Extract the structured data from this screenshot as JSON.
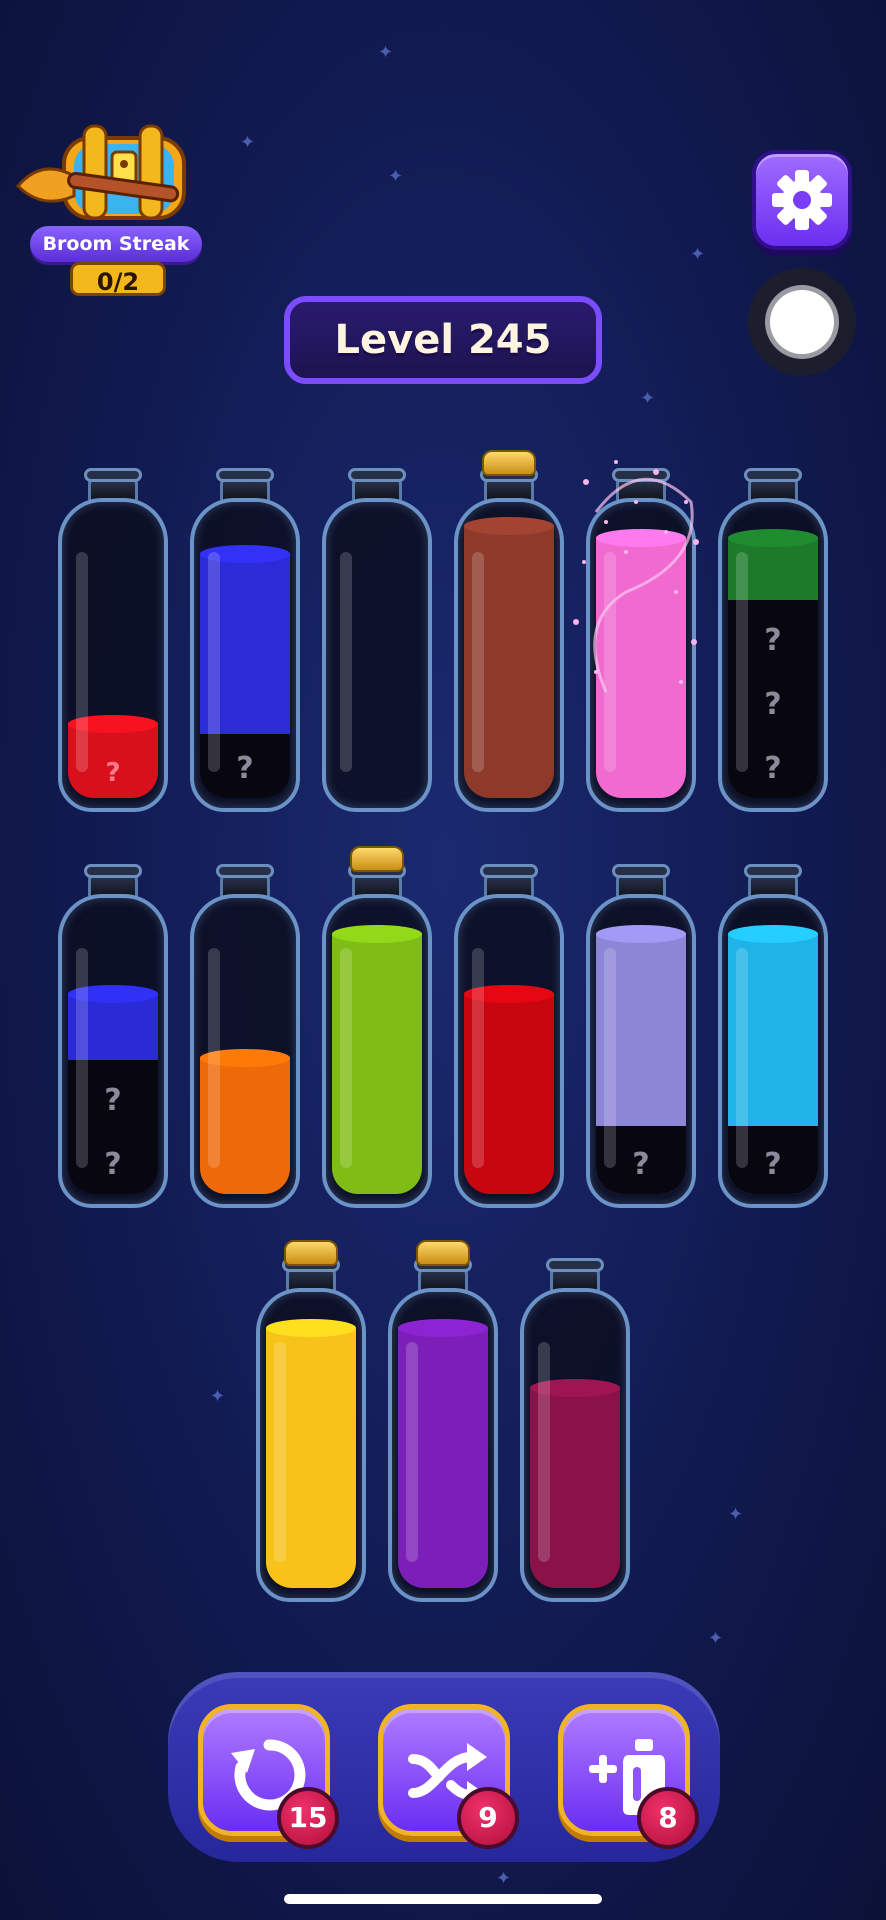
{
  "header": {
    "broom_streak_label": "Broom Streak",
    "broom_streak_count": "0/2",
    "level_label": "Level 245"
  },
  "bottles": [
    {
      "id": 1,
      "row": 1,
      "corked": false,
      "layers": [
        {
          "color": "#d8101c",
          "hidden_marker": "?"
        }
      ],
      "fill_fraction": 0.25
    },
    {
      "id": 2,
      "row": 1,
      "corked": false,
      "hidden_segments": 1,
      "visible_color": "#2c2bd8",
      "fill_fraction": 0.75
    },
    {
      "id": 3,
      "row": 1,
      "corked": false,
      "fill_fraction": 0
    },
    {
      "id": 4,
      "row": 1,
      "corked": true,
      "visible_color": "#8e3a2b",
      "fill_fraction": 1.0
    },
    {
      "id": 5,
      "row": 1,
      "corked": false,
      "visible_color": "#f06ad0",
      "fill_fraction": 1.0,
      "sparkle": true
    },
    {
      "id": 6,
      "row": 1,
      "corked": false,
      "hidden_segments": 3,
      "visible_color": "#1c7a2a",
      "fill_fraction": 1.0
    },
    {
      "id": 7,
      "row": 2,
      "corked": false,
      "hidden_segments": 2,
      "visible_color": "#2a2ad6",
      "fill_fraction": 0.75
    },
    {
      "id": 8,
      "row": 2,
      "corked": false,
      "visible_color": "#ee6a08",
      "fill_fraction": 0.5
    },
    {
      "id": 9,
      "row": 2,
      "corked": true,
      "visible_color": "#7fbd16",
      "fill_fraction": 1.0
    },
    {
      "id": 10,
      "row": 2,
      "corked": false,
      "visible_color": "#c80610",
      "fill_fraction": 0.75
    },
    {
      "id": 11,
      "row": 2,
      "corked": false,
      "hidden_segments": 1,
      "visible_color": "#8d86d6",
      "fill_fraction": 1.0
    },
    {
      "id": 12,
      "row": 2,
      "corked": false,
      "hidden_segments": 1,
      "visible_color": "#1fb3e8",
      "fill_fraction": 1.0
    },
    {
      "id": 13,
      "row": 3,
      "corked": true,
      "visible_color": "#f7c31a",
      "fill_fraction": 1.0
    },
    {
      "id": 14,
      "row": 3,
      "corked": true,
      "visible_color": "#7b1fb8",
      "fill_fraction": 1.0
    },
    {
      "id": 15,
      "row": 3,
      "corked": false,
      "visible_color": "#8a1248",
      "fill_fraction": 0.75
    }
  ],
  "hidden_marker": "?",
  "toolbar": {
    "undo_count": "15",
    "shuffle_count": "9",
    "add_bottle_count": "8"
  },
  "icons": {
    "settings": "gear-icon",
    "undo": "undo-icon",
    "shuffle": "shuffle-icon",
    "add_bottle": "add-bottle-icon",
    "record": "record-icon",
    "treasure": "treasure-chest-icon"
  }
}
